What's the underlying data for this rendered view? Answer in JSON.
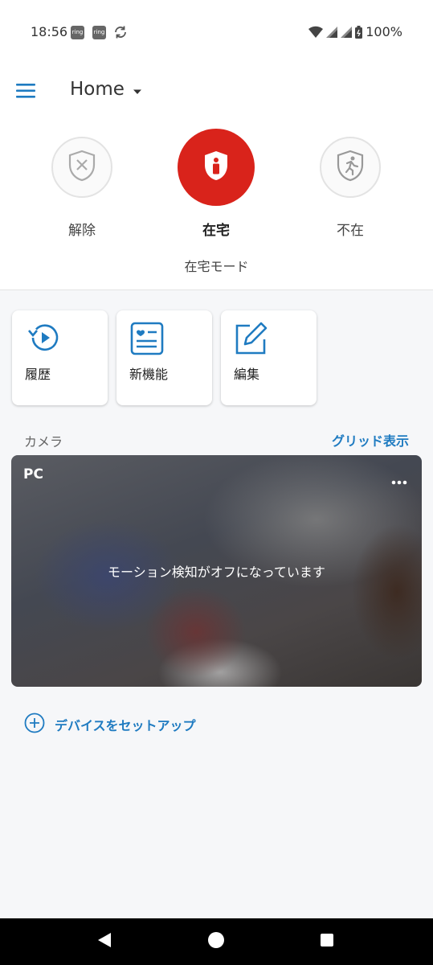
{
  "status_bar": {
    "time": "18:56",
    "app_icon_1": "ring",
    "app_icon_2": "ring",
    "battery": "100%"
  },
  "header": {
    "title": "Home"
  },
  "modes": {
    "disarm_label": "解除",
    "home_label": "在宅",
    "away_label": "不在",
    "current_mode": "在宅モード",
    "active_color": "#d9231b"
  },
  "tiles": {
    "history": "履歴",
    "new_features": "新機能",
    "edit": "編集"
  },
  "cameras": {
    "section_title": "カメラ",
    "grid_link": "グリッド表示",
    "items": [
      {
        "name": "PC",
        "message": "モーション検知がオフになっています"
      }
    ]
  },
  "setup": {
    "label": "デバイスをセットアップ"
  },
  "colors": {
    "accent": "#1f7bc1",
    "brand_red": "#d9231b"
  }
}
